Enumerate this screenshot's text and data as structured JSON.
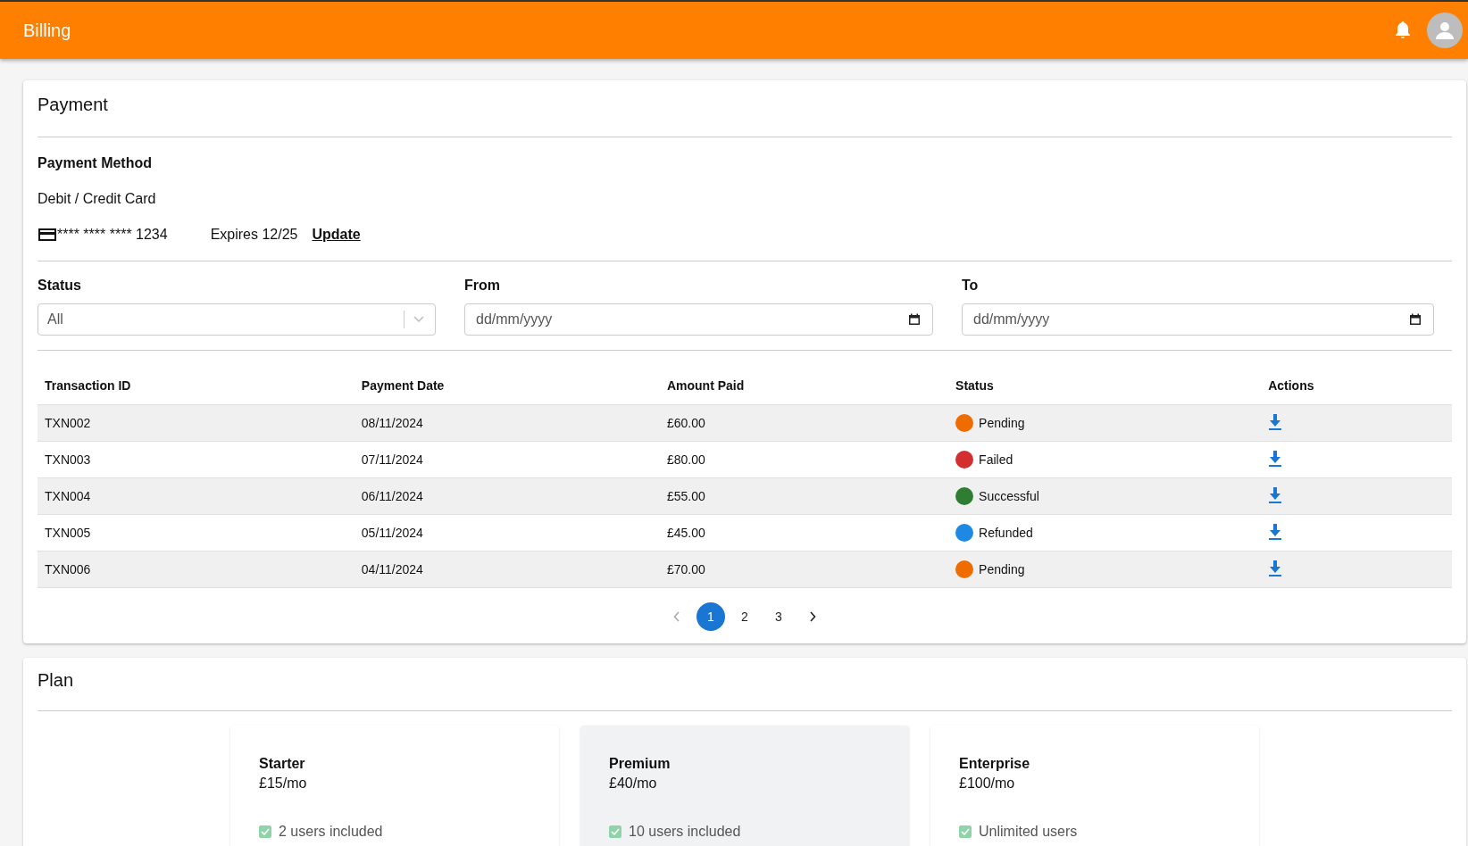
{
  "header": {
    "title": "Billing"
  },
  "payment": {
    "title": "Payment",
    "method_heading": "Payment Method",
    "method_type": "Debit / Credit Card",
    "card_number": "**** **** **** 1234",
    "expiry": "Expires 12/25",
    "update_link": "Update",
    "filters": [
      {
        "kind": "select",
        "label": "Status",
        "value": "All"
      },
      {
        "kind": "date",
        "label": "From",
        "placeholder": "dd/mm/yyyy"
      },
      {
        "kind": "date",
        "label": "To",
        "placeholder": "dd/mm/yyyy"
      }
    ],
    "table": {
      "columns": [
        "Transaction ID",
        "Payment Date",
        "Amount Paid",
        "Status",
        "Actions"
      ],
      "rows": [
        {
          "id": "TXN002",
          "date": "08/11/2024",
          "amount": "£60.00",
          "status": "Pending",
          "color": "#ef6c00"
        },
        {
          "id": "TXN003",
          "date": "07/11/2024",
          "amount": "£80.00",
          "status": "Failed",
          "color": "#d32f2f"
        },
        {
          "id": "TXN004",
          "date": "06/11/2024",
          "amount": "£55.00",
          "status": "Successful",
          "color": "#2e7d32"
        },
        {
          "id": "TXN005",
          "date": "05/11/2024",
          "amount": "£45.00",
          "status": "Refunded",
          "color": "#1e88e5"
        },
        {
          "id": "TXN006",
          "date": "04/11/2024",
          "amount": "£70.00",
          "status": "Pending",
          "color": "#ef6c00"
        }
      ]
    },
    "pagination": {
      "prev_disabled": true,
      "pages": [
        {
          "label": "1",
          "selected": true
        },
        {
          "label": "2",
          "selected": false
        },
        {
          "label": "3",
          "selected": false
        }
      ]
    }
  },
  "plan": {
    "title": "Plan",
    "plans": [
      {
        "name": "Starter",
        "price": "£15/mo",
        "selected": false,
        "features": [
          {
            "label": "2 users included",
            "checked": true
          }
        ]
      },
      {
        "name": "Premium",
        "price": "£40/mo",
        "selected": true,
        "features": [
          {
            "label": "10 users included",
            "checked": true
          }
        ]
      },
      {
        "name": "Enterprise",
        "price": "£100/mo",
        "selected": false,
        "features": [
          {
            "label": "Unlimited users",
            "checked": true
          }
        ]
      }
    ]
  }
}
